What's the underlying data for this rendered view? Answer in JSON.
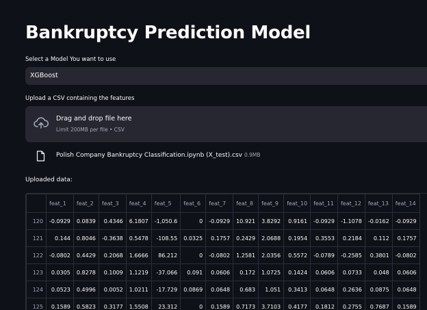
{
  "page": {
    "title": "Bankruptcy Prediction Model",
    "model_select": {
      "label": "Select a Model You want to use",
      "value": "XGBoost"
    },
    "upload": {
      "label": "Upload a CSV containing the features",
      "dropzone_title": "Drag and drop file here",
      "dropzone_sub": "Limit 200MB per file • CSV",
      "file_name": "Polish Company Bankruptcy Classification.ipynb (X_test).csv",
      "file_size": "0.9MB"
    },
    "uploaded_label": "Uploaded data:"
  },
  "table": {
    "columns": [
      "feat_1",
      "feat_2",
      "feat_3",
      "feat_4",
      "feat_5",
      "feat_6",
      "feat_7",
      "feat_8",
      "feat_9",
      "feat_10",
      "feat_11",
      "feat_12",
      "feat_13",
      "feat_14"
    ],
    "rows": [
      {
        "index": "120",
        "cells": [
          "-0.0929",
          "0.0839",
          "0.4346",
          "6.1807",
          "-1,050.6",
          "0",
          "-0.0929",
          "10.921",
          "3.8292",
          "0.9161",
          "-0.0929",
          "-1.1078",
          "-0.0162",
          "-0.0929"
        ]
      },
      {
        "index": "121",
        "cells": [
          "0.144",
          "0.8046",
          "-0.3638",
          "0.5478",
          "-108.55",
          "0.0325",
          "0.1757",
          "0.2429",
          "2.0688",
          "0.1954",
          "0.3553",
          "0.2184",
          "0.112",
          "0.1757"
        ]
      },
      {
        "index": "122",
        "cells": [
          "-0.0802",
          "0.4429",
          "0.2068",
          "1.6666",
          "86.212",
          "0",
          "-0.0802",
          "1.2581",
          "2.0356",
          "0.5572",
          "-0.0789",
          "-0.2585",
          "0.3801",
          "-0.0802"
        ]
      },
      {
        "index": "123",
        "cells": [
          "0.0305",
          "0.8278",
          "0.1009",
          "1.1219",
          "-37.066",
          "0.091",
          "0.0606",
          "0.172",
          "1.0725",
          "0.1424",
          "0.0606",
          "0.0733",
          "0.048",
          "0.0606"
        ]
      },
      {
        "index": "124",
        "cells": [
          "0.0523",
          "0.4996",
          "0.0052",
          "1.0211",
          "-17.729",
          "0.0869",
          "0.0648",
          "0.683",
          "1.051",
          "0.3413",
          "0.0648",
          "0.2636",
          "0.0875",
          "0.0648"
        ]
      },
      {
        "index": "125",
        "cells": [
          "0.1589",
          "0.5823",
          "0.3177",
          "1.5508",
          "23.312",
          "0",
          "0.1589",
          "0.7173",
          "3.7103",
          "0.4177",
          "0.1812",
          "0.2755",
          "0.7687",
          "0.1589"
        ]
      }
    ]
  },
  "icons": {
    "upload": "cloud-upload-icon",
    "file": "file-icon"
  },
  "colors": {
    "background": "#0e1117",
    "surface": "#262730",
    "muted": "#a3a8b8"
  }
}
